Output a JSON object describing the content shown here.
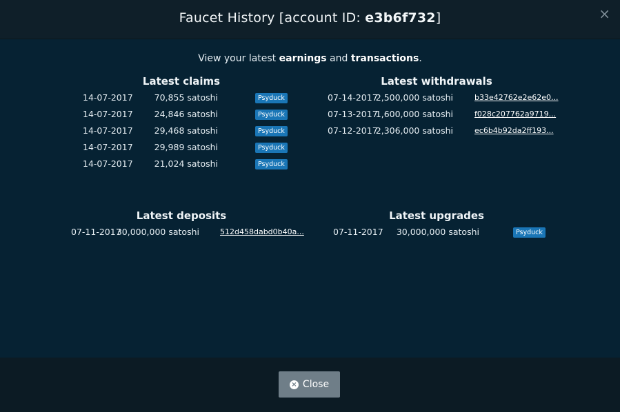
{
  "modal": {
    "title_prefix": "Faucet History [account ID: ",
    "account_id": "e3b6f732",
    "title_suffix": "]",
    "close_x": "×"
  },
  "intro": {
    "part1": "View your latest ",
    "bold1": "earnings",
    "part2": " and ",
    "bold2": "transactions",
    "part3": "."
  },
  "claims": {
    "title": "Latest claims",
    "rows": [
      {
        "date": "14-07-2017",
        "amount": "70,855 satoshi",
        "badge": "Psyduck"
      },
      {
        "date": "14-07-2017",
        "amount": "24,846 satoshi",
        "badge": "Psyduck"
      },
      {
        "date": "14-07-2017",
        "amount": "29,468 satoshi",
        "badge": "Psyduck"
      },
      {
        "date": "14-07-2017",
        "amount": "29,989 satoshi",
        "badge": "Psyduck"
      },
      {
        "date": "14-07-2017",
        "amount": "21,024 satoshi",
        "badge": "Psyduck"
      }
    ]
  },
  "withdrawals": {
    "title": "Latest withdrawals",
    "rows": [
      {
        "date": "07-14-2017",
        "amount": "2,500,000 satoshi",
        "tx": "b33e42762e2e62e0..."
      },
      {
        "date": "07-13-2017",
        "amount": "1,600,000 satoshi",
        "tx": "f028c207762a9719..."
      },
      {
        "date": "07-12-2017",
        "amount": "2,306,000 satoshi",
        "tx": "ec6b4b92da2ff193..."
      }
    ]
  },
  "deposits": {
    "title": "Latest deposits",
    "rows": [
      {
        "date": "07-11-2017",
        "amount": "30,000,000 satoshi",
        "tx": "512d458dabd0b40a..."
      }
    ]
  },
  "upgrades": {
    "title": "Latest upgrades",
    "rows": [
      {
        "date": "07-11-2017",
        "amount": "30,000,000 satoshi",
        "badge": "Psyduck"
      }
    ]
  },
  "footer": {
    "close_label": "Close"
  },
  "colors": {
    "badge": "#1a76b6",
    "body_bg": "#062233",
    "header_bg": "#0f1f29",
    "close_button": "#6f7e88"
  }
}
